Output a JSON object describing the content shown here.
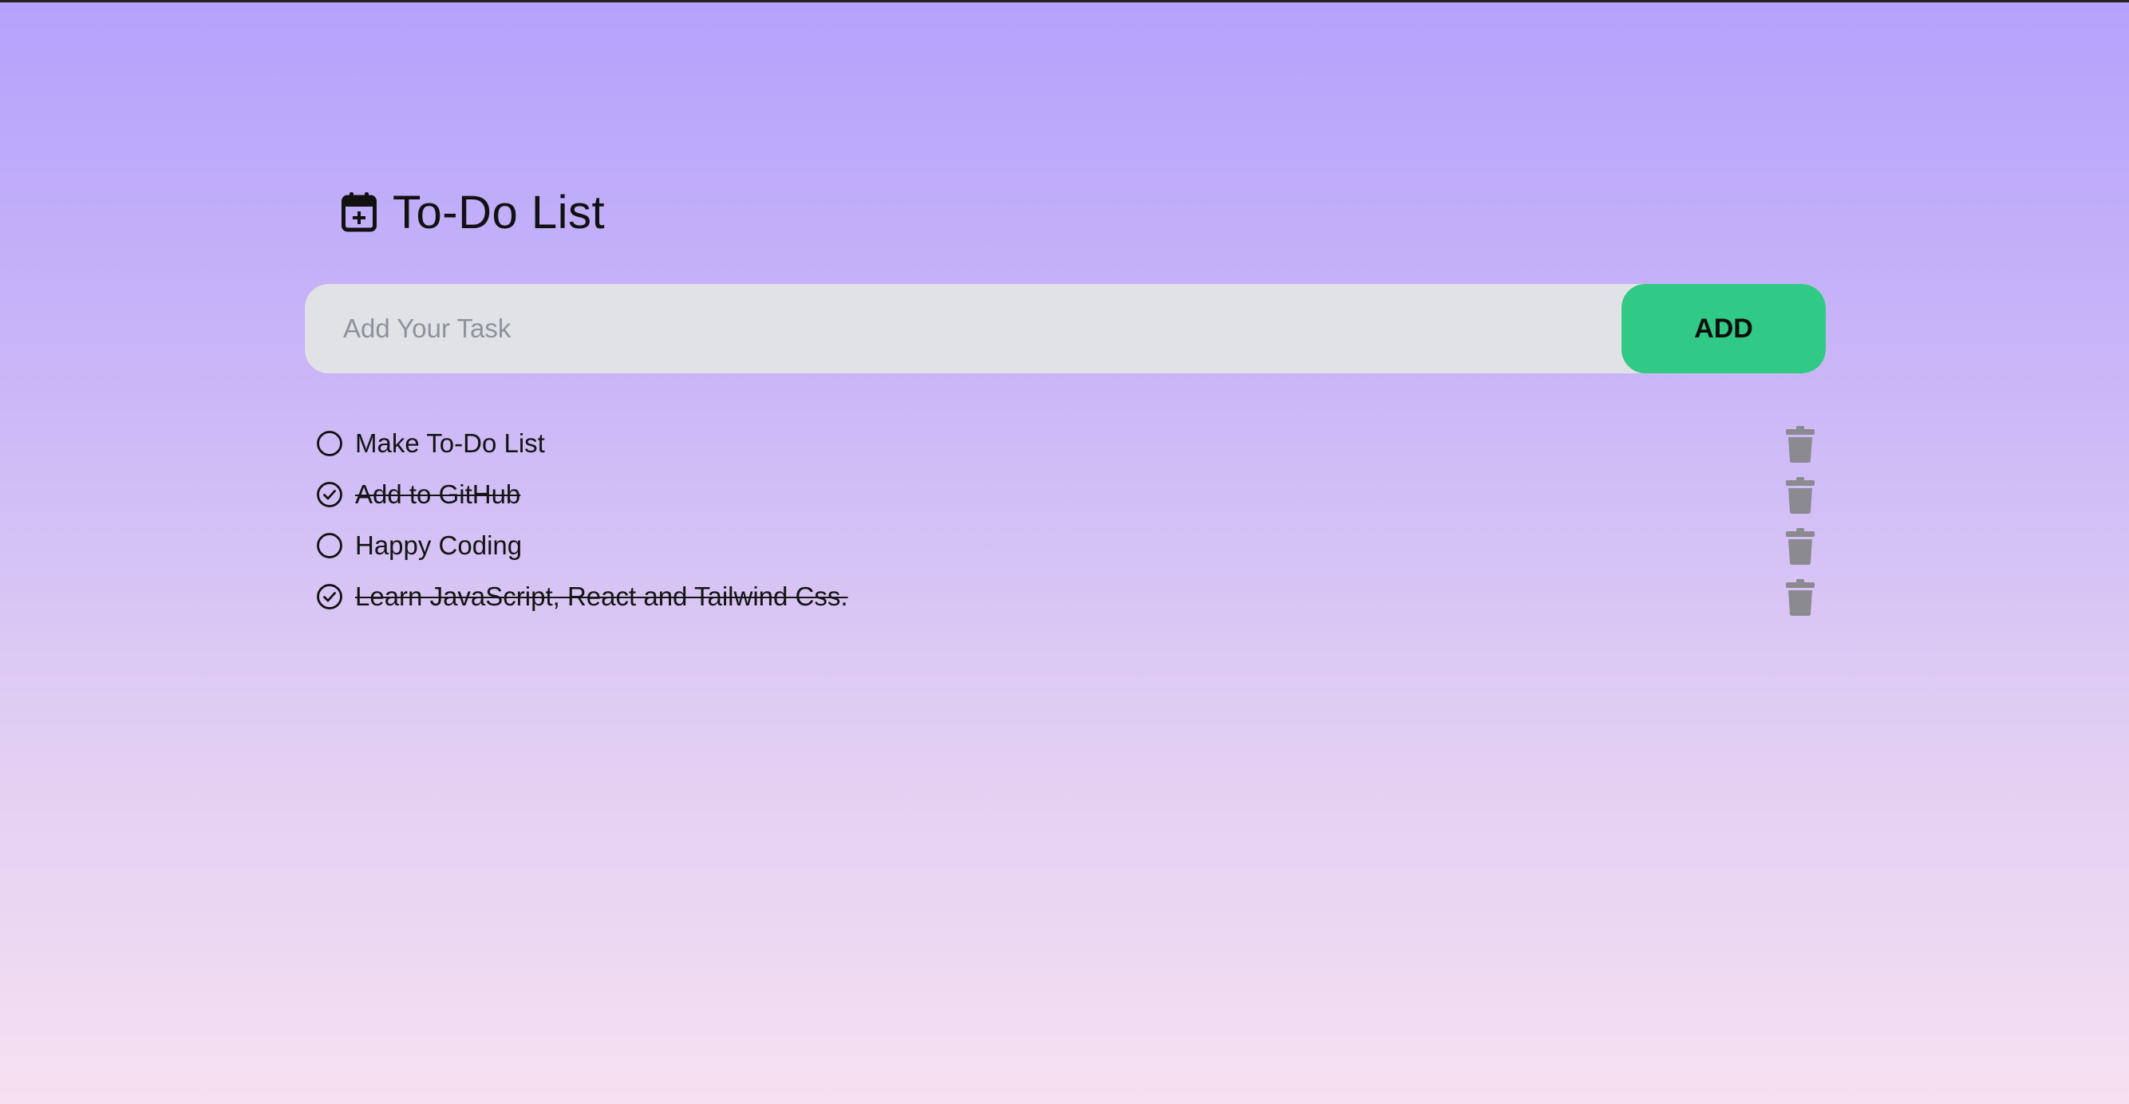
{
  "header": {
    "title": "To-Do List",
    "icon": "calendar-plus-icon"
  },
  "input": {
    "placeholder": "Add Your Task",
    "value": ""
  },
  "add_button": {
    "label": "ADD"
  },
  "colors": {
    "accent": "#30c985",
    "input_bg": "#e1e2e6",
    "trash": "#8a8a90",
    "bg_top": "#b5a2fc",
    "bg_bottom": "#f6e0f1"
  },
  "todos": [
    {
      "text": "Make To-Do List",
      "done": false
    },
    {
      "text": "Add to GitHub",
      "done": true
    },
    {
      "text": "Happy Coding",
      "done": false
    },
    {
      "text": "Learn JavaScript, React and Tailwind Css.",
      "done": true
    }
  ]
}
